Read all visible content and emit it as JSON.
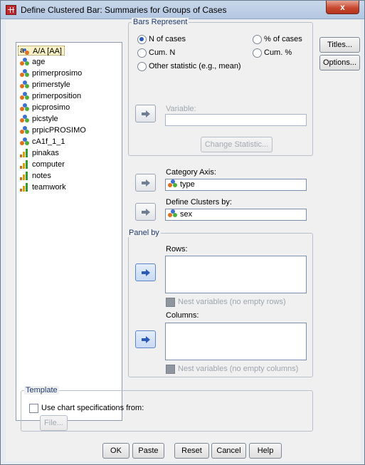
{
  "window": {
    "title": "Define Clustered Bar: Summaries for Groups of Cases",
    "close_label": "x"
  },
  "variables": [
    {
      "label": "A/A [AA]",
      "icon": "string-nominal-icon",
      "selected": true
    },
    {
      "label": "age",
      "icon": "nominal-icon"
    },
    {
      "label": "primerprosimo",
      "icon": "nominal-icon"
    },
    {
      "label": "primerstyle",
      "icon": "nominal-icon"
    },
    {
      "label": "primerposition",
      "icon": "nominal-icon"
    },
    {
      "label": "picprosimo",
      "icon": "nominal-icon"
    },
    {
      "label": "picstyle",
      "icon": "nominal-icon"
    },
    {
      "label": "prpicPROSIMO",
      "icon": "nominal-icon"
    },
    {
      "label": "cA1f_1_1",
      "icon": "nominal-icon"
    },
    {
      "label": "pinakas",
      "icon": "scale-icon"
    },
    {
      "label": "computer",
      "icon": "scale-icon"
    },
    {
      "label": "notes",
      "icon": "scale-icon"
    },
    {
      "label": "teamwork",
      "icon": "scale-icon"
    }
  ],
  "bars_represent": {
    "legend": "Bars Represent",
    "options": [
      {
        "label": "N of cases",
        "checked": true
      },
      {
        "label": "% of cases",
        "checked": false
      },
      {
        "label": "Cum. N",
        "checked": false
      },
      {
        "label": "Cum. %",
        "checked": false
      },
      {
        "label": "Other statistic (e.g., mean)",
        "checked": false
      }
    ],
    "variable_label": "Variable:",
    "variable_value": "",
    "change_statistic_label": "Change Statistic..."
  },
  "category_axis": {
    "label": "Category Axis:",
    "value": "type"
  },
  "define_clusters": {
    "label": "Define Clusters by:",
    "value": "sex"
  },
  "panel_by": {
    "legend": "Panel by",
    "rows_label": "Rows:",
    "rows_nest_label": "Nest variables (no empty rows)",
    "columns_label": "Columns:",
    "columns_nest_label": "Nest variables (no empty columns)"
  },
  "template": {
    "legend": "Template",
    "use_spec_label": "Use chart specifications from:",
    "file_label": "File..."
  },
  "side_buttons": {
    "titles": "Titles...",
    "options": "Options..."
  },
  "footer_buttons": {
    "ok": "OK",
    "paste": "Paste",
    "reset": "Reset",
    "cancel": "Cancel",
    "help": "Help"
  }
}
